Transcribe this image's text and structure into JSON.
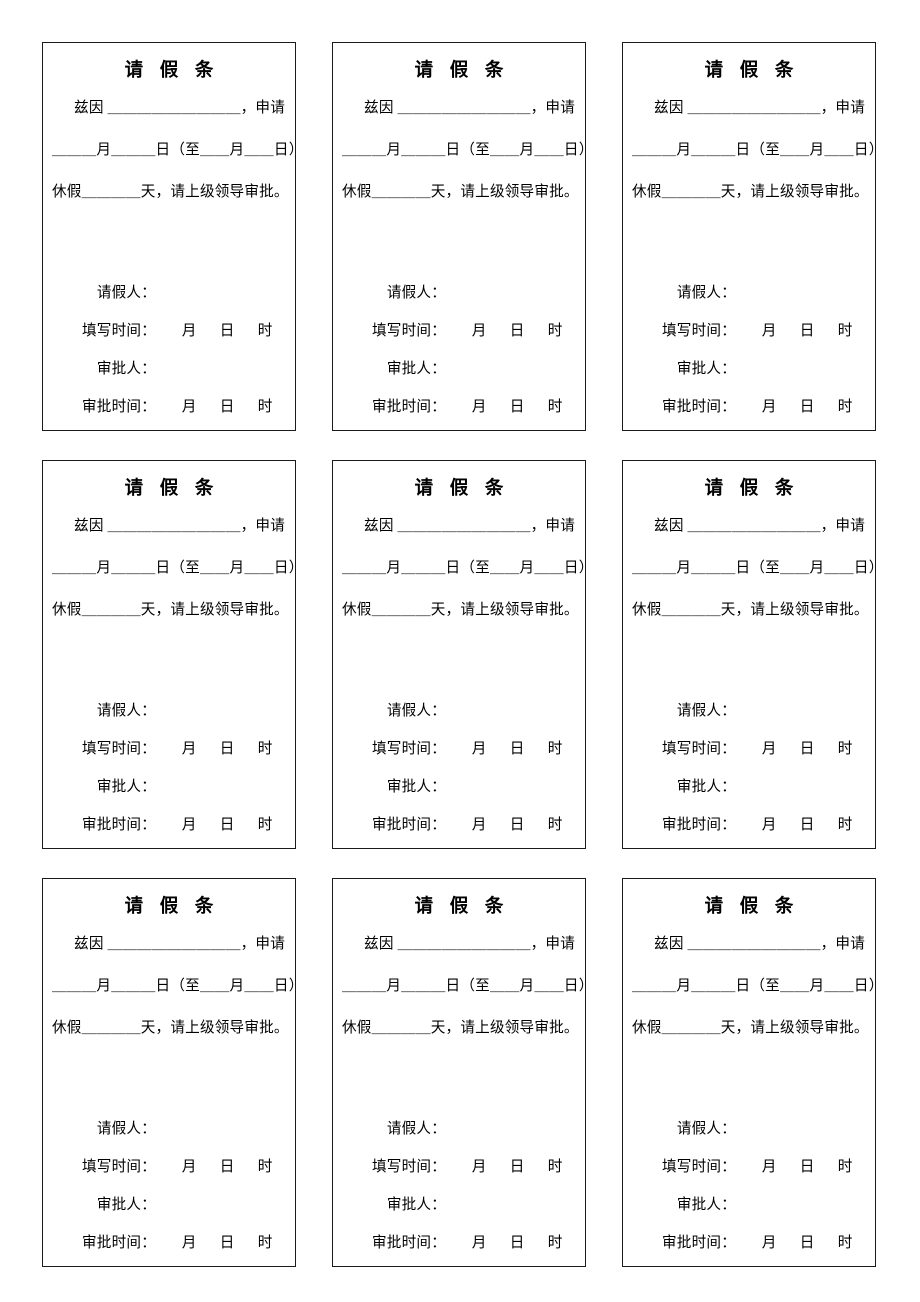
{
  "document": {
    "type": "printable-form-sheet",
    "page_background": "#ffffff",
    "border_color": "#1b1b1b",
    "grid": {
      "rows": 3,
      "columns": 3,
      "total_slips": 9
    }
  },
  "slip": {
    "title": "请 假 条",
    "line_reason": "兹因 ＿＿＿＿＿＿＿＿＿，申请",
    "line_dates": "＿＿＿月＿＿＿日（至＿＿月＿＿日）",
    "line_days": "休假＿＿＿＿天，请上级领导审批。",
    "applicant_label": "请假人：",
    "fill_time_label": "填写时间：",
    "approver_label": "审批人：",
    "approve_time_label": "审批时间：",
    "unit_month": "月",
    "unit_day": "日",
    "unit_hour": "时"
  },
  "slips": [
    {
      "index": 1
    },
    {
      "index": 2
    },
    {
      "index": 3
    },
    {
      "index": 4
    },
    {
      "index": 5
    },
    {
      "index": 6
    },
    {
      "index": 7
    },
    {
      "index": 8
    },
    {
      "index": 9
    }
  ]
}
